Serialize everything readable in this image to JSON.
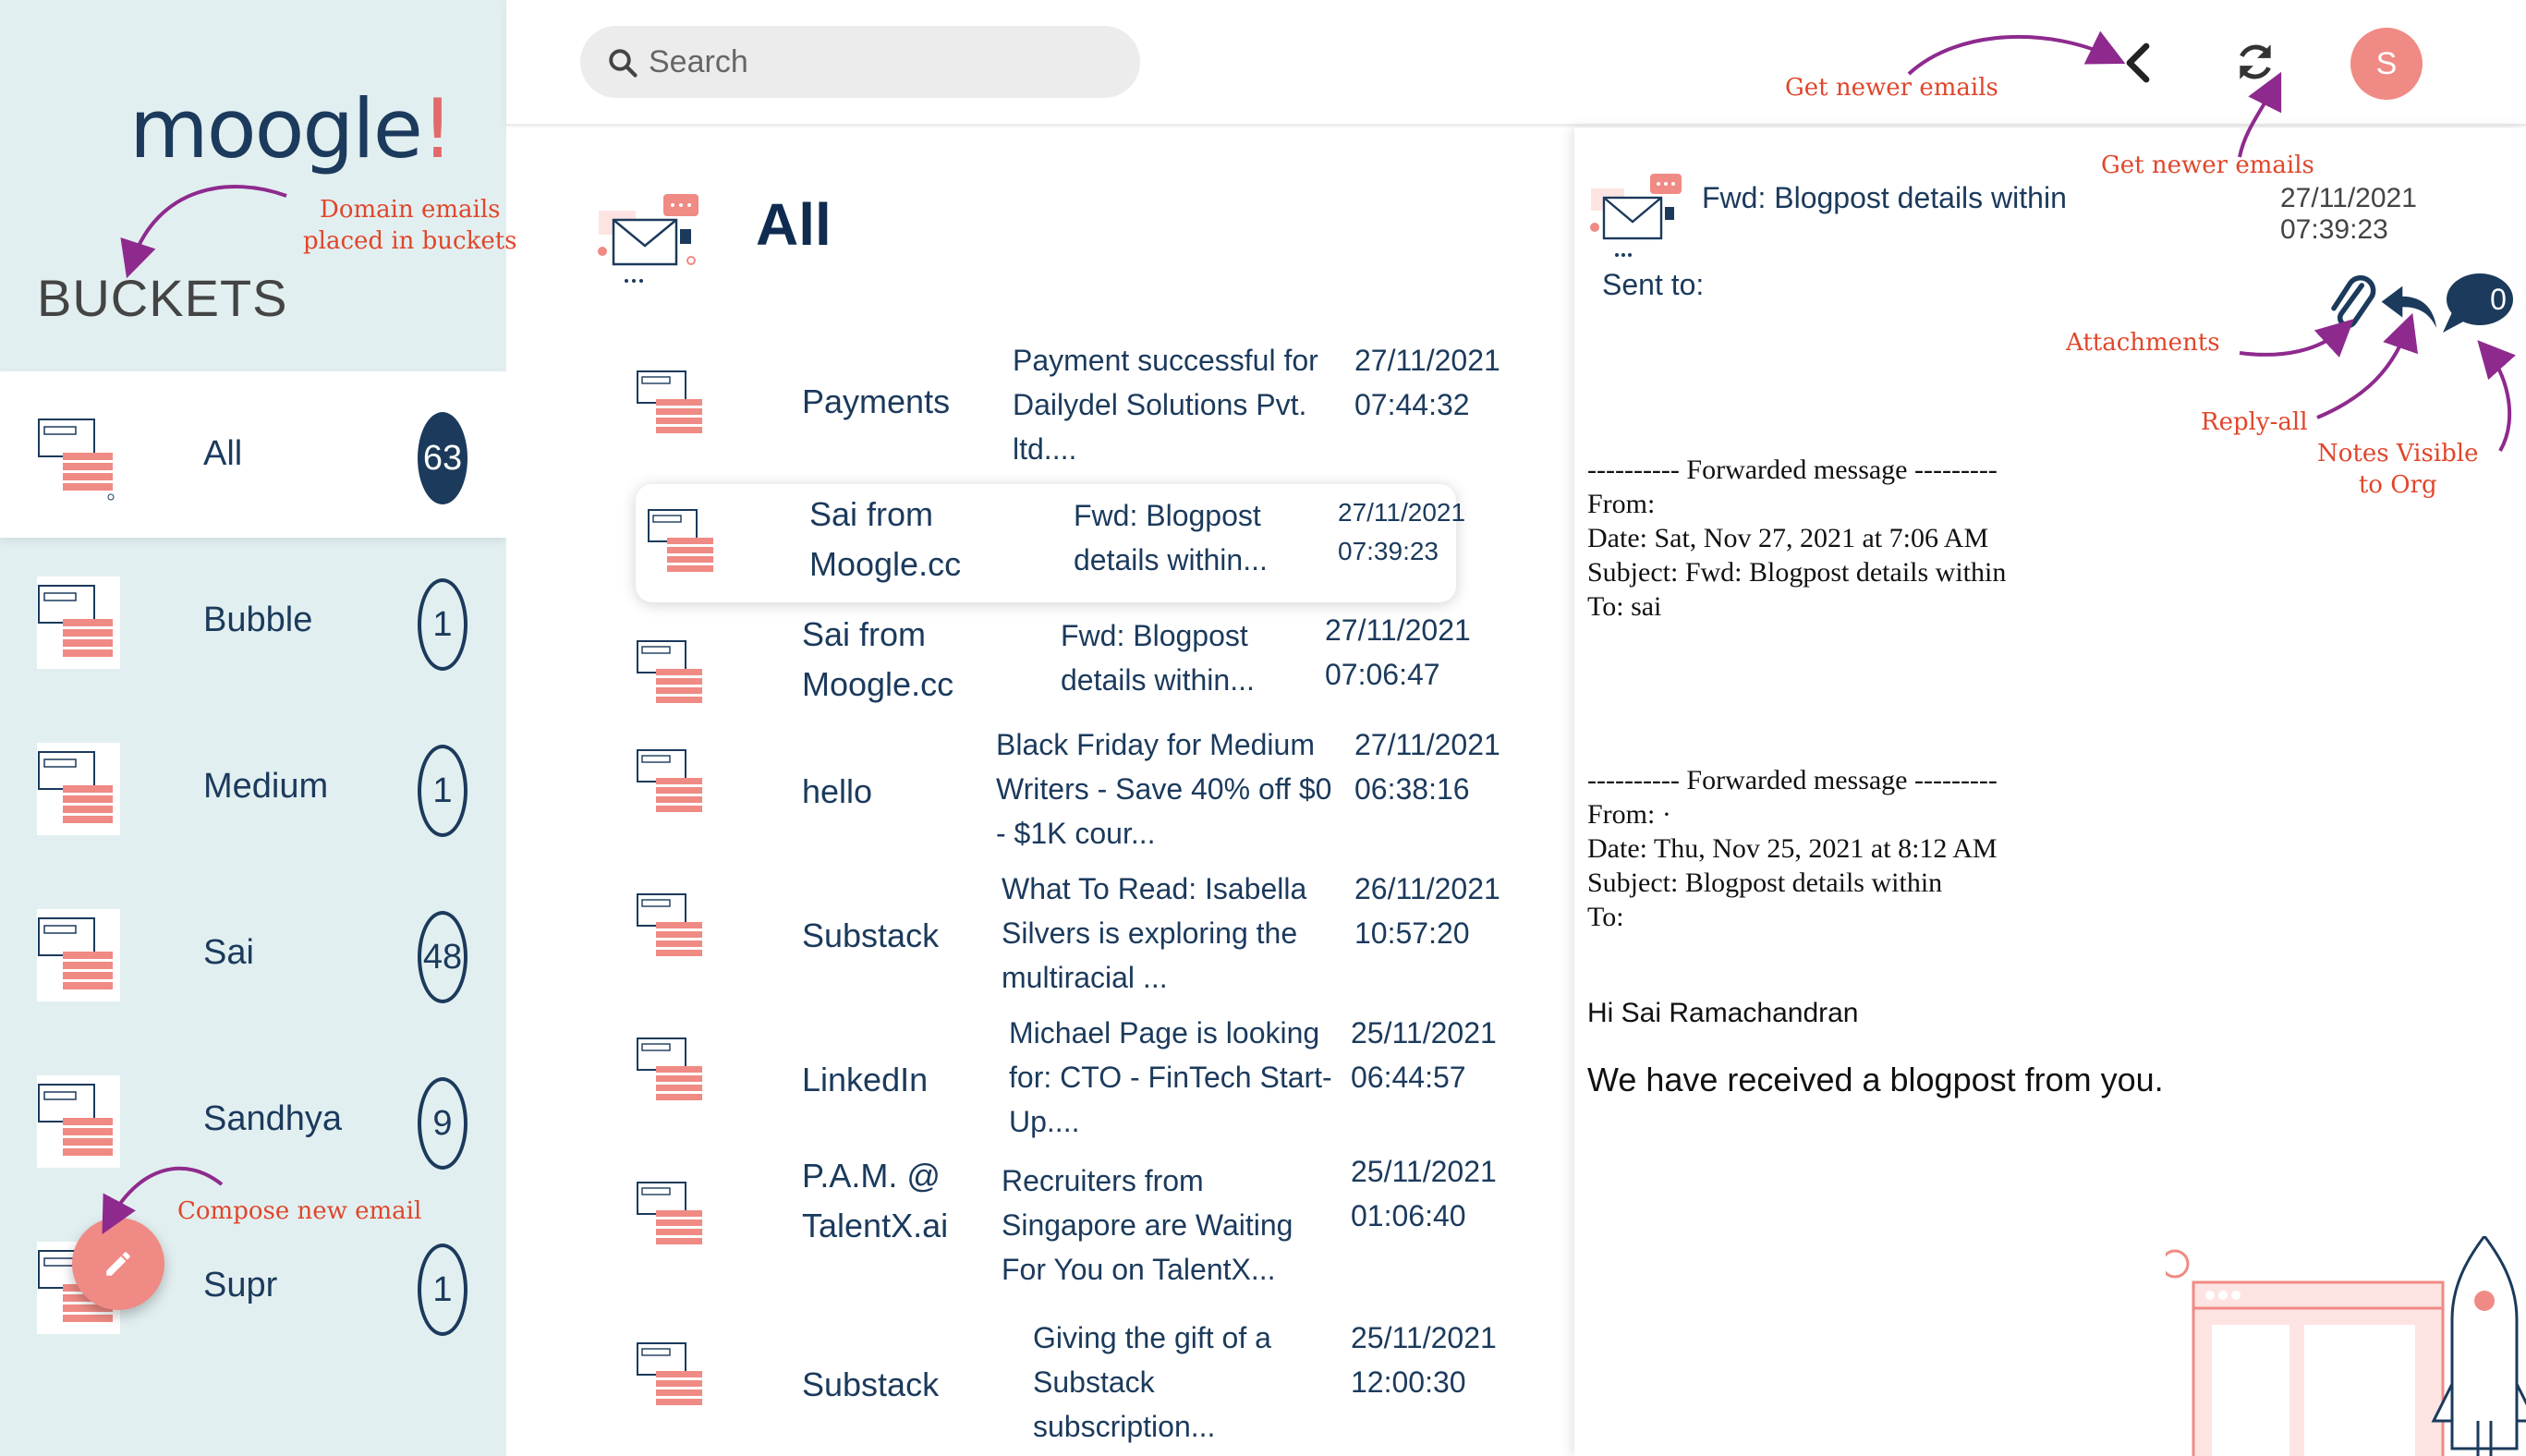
{
  "app": {
    "logo_main": "moogle",
    "logo_accent": "!"
  },
  "sidebar": {
    "title": "BUCKETS",
    "items": [
      {
        "label": "All",
        "count": "63",
        "active": true
      },
      {
        "label": "Bubble",
        "count": "1"
      },
      {
        "label": "Medium",
        "count": "1"
      },
      {
        "label": "Sai",
        "count": "48"
      },
      {
        "label": "Sandhya",
        "count": "9"
      },
      {
        "label": "Supr",
        "count": "1"
      }
    ]
  },
  "search": {
    "placeholder": "Search"
  },
  "header": {
    "avatar_initial": "S"
  },
  "list": {
    "title": "All",
    "rows": [
      {
        "sender": "Payments",
        "subject": "Payment successful for Dailydel Solutions Pvt. ltd....",
        "date": "27/11/2021",
        "time": "07:44:32"
      },
      {
        "sender": "Sai from Moogle.cc",
        "subject": "Fwd: Blogpost details within...",
        "date": "27/11/2021",
        "time": "07:39:23",
        "selected": true
      },
      {
        "sender": "Sai from Moogle.cc",
        "subject": "Fwd: Blogpost details within...",
        "date": "27/11/2021",
        "time": "07:06:47"
      },
      {
        "sender": "hello",
        "subject": "Black Friday for Medium Writers - Save 40% off $0 - $1K cour...",
        "date": "27/11/2021",
        "time": "06:38:16"
      },
      {
        "sender": "Substack",
        "subject": "What To Read: Isabella Silvers is exploring the multiracial ...",
        "date": "26/11/2021",
        "time": "10:57:20"
      },
      {
        "sender": "LinkedIn",
        "subject": "Michael Page is looking for: CTO - FinTech Start-Up....",
        "date": "25/11/2021",
        "time": "06:44:57"
      },
      {
        "sender": "P.A.M. @ TalentX.ai",
        "subject": "Recruiters from Singapore are Waiting For You on TalentX...",
        "date": "25/11/2021",
        "time": "01:06:40"
      },
      {
        "sender": "Substack",
        "subject": "Giving the gift of a Substack subscription...",
        "date": "25/11/2021",
        "time": "12:00:30"
      }
    ]
  },
  "preview": {
    "subject": "Fwd: Blogpost details within",
    "date": "27/11/2021 07:39:23",
    "sent_to": "Sent to:",
    "notes_count": "0",
    "fwd1": {
      "line": "---------- Forwarded message ---------",
      "from": "From:",
      "date": "Date: Sat, Nov 27, 2021 at 7:06 AM",
      "subject": "Subject: Fwd: Blogpost details within",
      "to": "To: sai"
    },
    "fwd2": {
      "line": "---------- Forwarded message ---------",
      "from": "From: ·",
      "date": "Date: Thu, Nov 25, 2021 at 8:12 AM",
      "subject": "Subject: Blogpost details within",
      "to": "To:"
    },
    "greeting": "Hi Sai Ramachandran",
    "message": "We have received a blogpost from you."
  },
  "annotations": {
    "buckets": "Domain emails\nplaced in buckets",
    "newer_1": "Get newer emails",
    "newer_2": "Get newer emails",
    "attachments": "Attachments",
    "reply_all": "Reply-all",
    "notes": "Notes Visible\nto Org",
    "compose": "Compose new email"
  },
  "colors": {
    "navy": "#1b3a5c",
    "coral": "#f08a84",
    "sidebar_bg": "#e2eff0",
    "annotation": "#e0462b",
    "arrow": "#8e2a8e"
  }
}
